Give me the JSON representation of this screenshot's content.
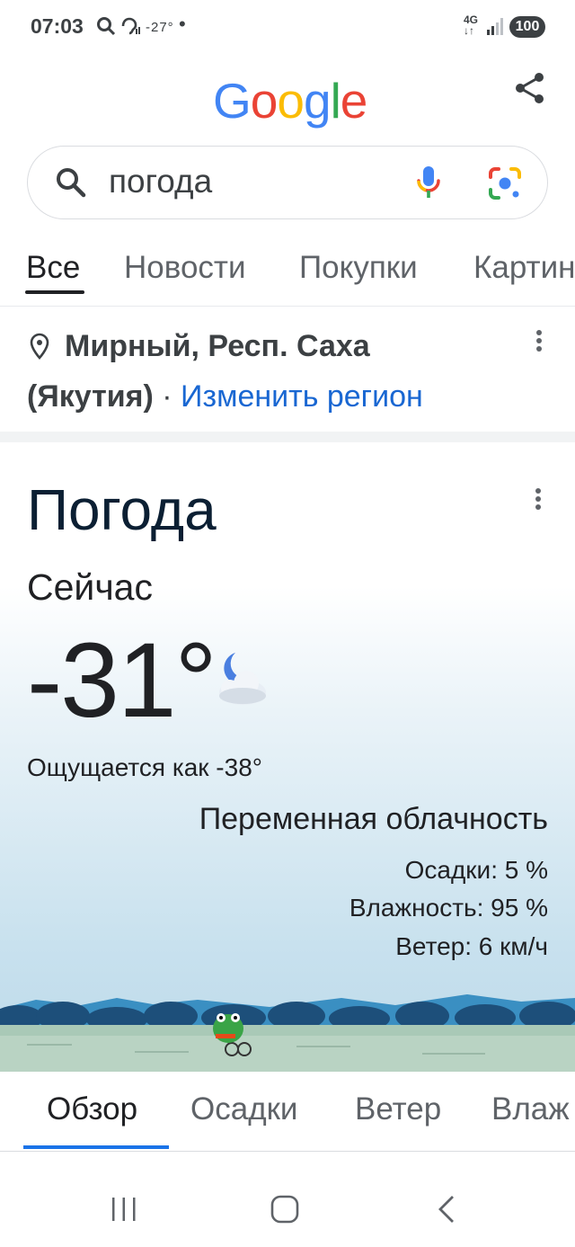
{
  "status_bar": {
    "time": "07:03",
    "notification_text": "-27°",
    "network": "4G",
    "battery": "100"
  },
  "header": {
    "logo": [
      "G",
      "o",
      "o",
      "g",
      "l",
      "e"
    ],
    "logo_colors": [
      "#4285F4",
      "#EA4335",
      "#FBBC05",
      "#4285F4",
      "#34A853",
      "#EA4335"
    ]
  },
  "search": {
    "query": "погода"
  },
  "tabs": {
    "items": [
      "Все",
      "Новости",
      "Покупки",
      "Картин"
    ]
  },
  "location": {
    "line1": "Мирный, Респ. Саха",
    "line2_place": "(Якутия)",
    "separator": " · ",
    "change_region": "Изменить регион"
  },
  "weather": {
    "title": "Погода",
    "now_label": "Сейчас",
    "temperature": "-31°",
    "feels_like": "Ощущается как -38°",
    "condition": "Переменная облачность",
    "precipitation": "Осадки: 5 %",
    "humidity": "Влажность: 95 %",
    "wind": "Ветер: 6 км/ч",
    "icon": "partly-cloudy-night-icon"
  },
  "weather_tabs": {
    "items": [
      "Обзор",
      "Осадки",
      "Ветер",
      "Влаж"
    ]
  },
  "colors": {
    "accent_blue": "#1a73e8",
    "link_blue": "#1967d2"
  }
}
